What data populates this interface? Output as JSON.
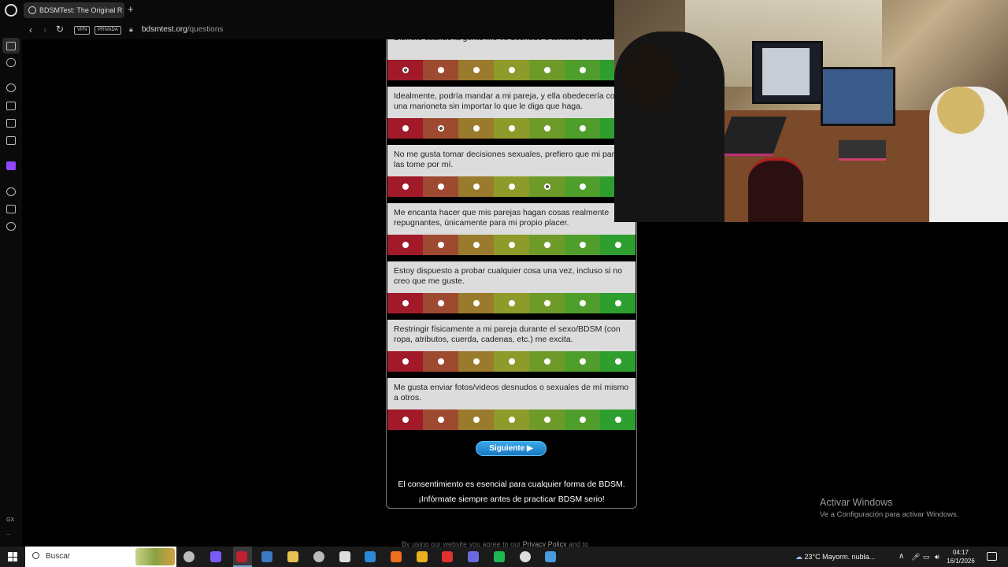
{
  "browser": {
    "tab_title": "BDSMTest: The Original R",
    "new_tab": "+",
    "badge_vpn": "VPN",
    "badge_private": "PRIVADA",
    "url_host": "bdsmtest.org",
    "url_path": "/questions"
  },
  "sidebar": {
    "icons": [
      "home-icon",
      "gamepad-icon",
      "refresh-icon",
      "flask-icon",
      "film-icon",
      "m-icon",
      "twitch-icon",
      "spotify-icon",
      "cube-icon",
      "settings-icon"
    ],
    "gx_label": "GX",
    "more_label": "..."
  },
  "quiz": {
    "scale_colors": [
      "#a11a2a",
      "#9e4a30",
      "#9a7a2c",
      "#8e9a2a",
      "#6e9a2a",
      "#4f9e2c",
      "#2e9e2e"
    ],
    "questions": [
      {
        "text": "Disfruto cuando la gente me ve desnudo o teniendo sexo",
        "selected": 0
      },
      {
        "text": "Idealmente, podría mandar a mi pareja, y ella obedecería como una marioneta sin importar lo que le diga que haga.",
        "selected": 1
      },
      {
        "text": "No me gusta tomar decisiones sexuales, prefiero que mi pareja las tome por mí.",
        "selected": 4
      },
      {
        "text": "Me encanta hacer que mis parejas hagan cosas realmente repugnantes, únicamente para mi propio placer.",
        "selected": null
      },
      {
        "text": "Estoy dispuesto a probar cualquier cosa una vez, incluso si no creo que me guste.",
        "selected": null
      },
      {
        "text": "Restringir físicamente a mi pareja durante el sexo/BDSM (con ropa, atributos, cuerda, cadenas, etc.) me excita.",
        "selected": null
      },
      {
        "text": "Me gusta enviar fotos/videos desnudos o sexuales de mí mismo a otros.",
        "selected": null
      }
    ],
    "next_button": "Siguiente ▶",
    "consent_line1": "El consentimiento es esencial para cualquier forma de BDSM.",
    "consent_line2": "¡Infórmate siempre antes de practicar BDSM serio!",
    "footer_prefix": "By using our website you agree to our",
    "footer_link": "Privacy Policy",
    "footer_suffix": "and to"
  },
  "watermark": {
    "title": "Activar Windows",
    "subtitle": "Ve a Configuración para activar Windows."
  },
  "taskbar": {
    "search_placeholder": "Buscar",
    "weather": "23°C  Mayorm. nubla...",
    "time": "04:17",
    "date": "16/1/2026",
    "icon_colors": [
      "#bbb",
      "#7a5af8",
      "#c02030",
      "#3a7ac0",
      "#e8c050",
      "#bbb",
      "#ddd",
      "#2a8ad8",
      "#f07020",
      "#e8b020",
      "#e03030",
      "#6a6ae0",
      "#1db954",
      "#ddd",
      "#4a9ae0"
    ]
  }
}
